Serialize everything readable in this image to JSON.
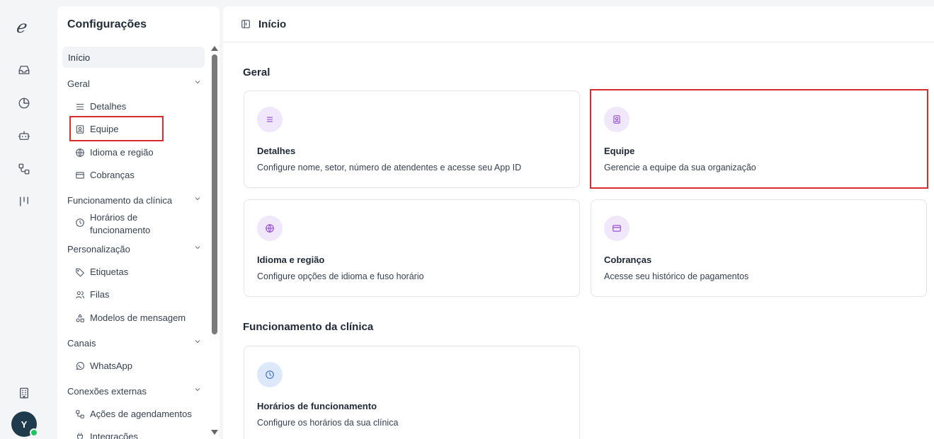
{
  "rail": {
    "logo": "ℯ",
    "avatar_initial": "Y"
  },
  "sidebar": {
    "title": "Configurações",
    "home": "Início",
    "sections": [
      {
        "label": "Geral",
        "items": [
          "Detalhes",
          "Equipe",
          "Idioma e região",
          "Cobranças"
        ]
      },
      {
        "label": "Funcionamento da clínica",
        "items": [
          "Horários de funcionamento"
        ]
      },
      {
        "label": "Personalização",
        "items": [
          "Etiquetas",
          "Filas",
          "Modelos de mensagem"
        ]
      },
      {
        "label": "Canais",
        "items": [
          "WhatsApp"
        ]
      },
      {
        "label": "Conexões externas",
        "items": [
          "Ações de agendamentos",
          "Integrações"
        ]
      }
    ]
  },
  "main": {
    "breadcrumb": "Início",
    "sections": [
      {
        "title": "Geral",
        "cards": [
          {
            "title": "Detalhes",
            "desc": "Configure nome, setor, número de atendentes e acesse seu App ID",
            "icon": "list-icon"
          },
          {
            "title": "Equipe",
            "desc": "Gerencie a equipe da sua organização",
            "icon": "contact-icon"
          },
          {
            "title": "Idioma e região",
            "desc": "Configure opções de idioma e fuso horário",
            "icon": "globe-icon"
          },
          {
            "title": "Cobranças",
            "desc": "Acesse seu histórico de pagamentos",
            "icon": "credit-card-icon"
          }
        ]
      },
      {
        "title": "Funcionamento da clínica",
        "cards": [
          {
            "title": "Horários de funcionamento",
            "desc": "Configure os horários da sua clínica",
            "icon": "clock-icon"
          }
        ]
      }
    ]
  },
  "colors": {
    "highlight": "#d92d2d",
    "purple_icon": "#8e44d6",
    "purple_bg": "#f1e7fb",
    "blue_icon": "#2f64c6",
    "blue_bg": "#dde9fb",
    "online": "#22c55e"
  }
}
